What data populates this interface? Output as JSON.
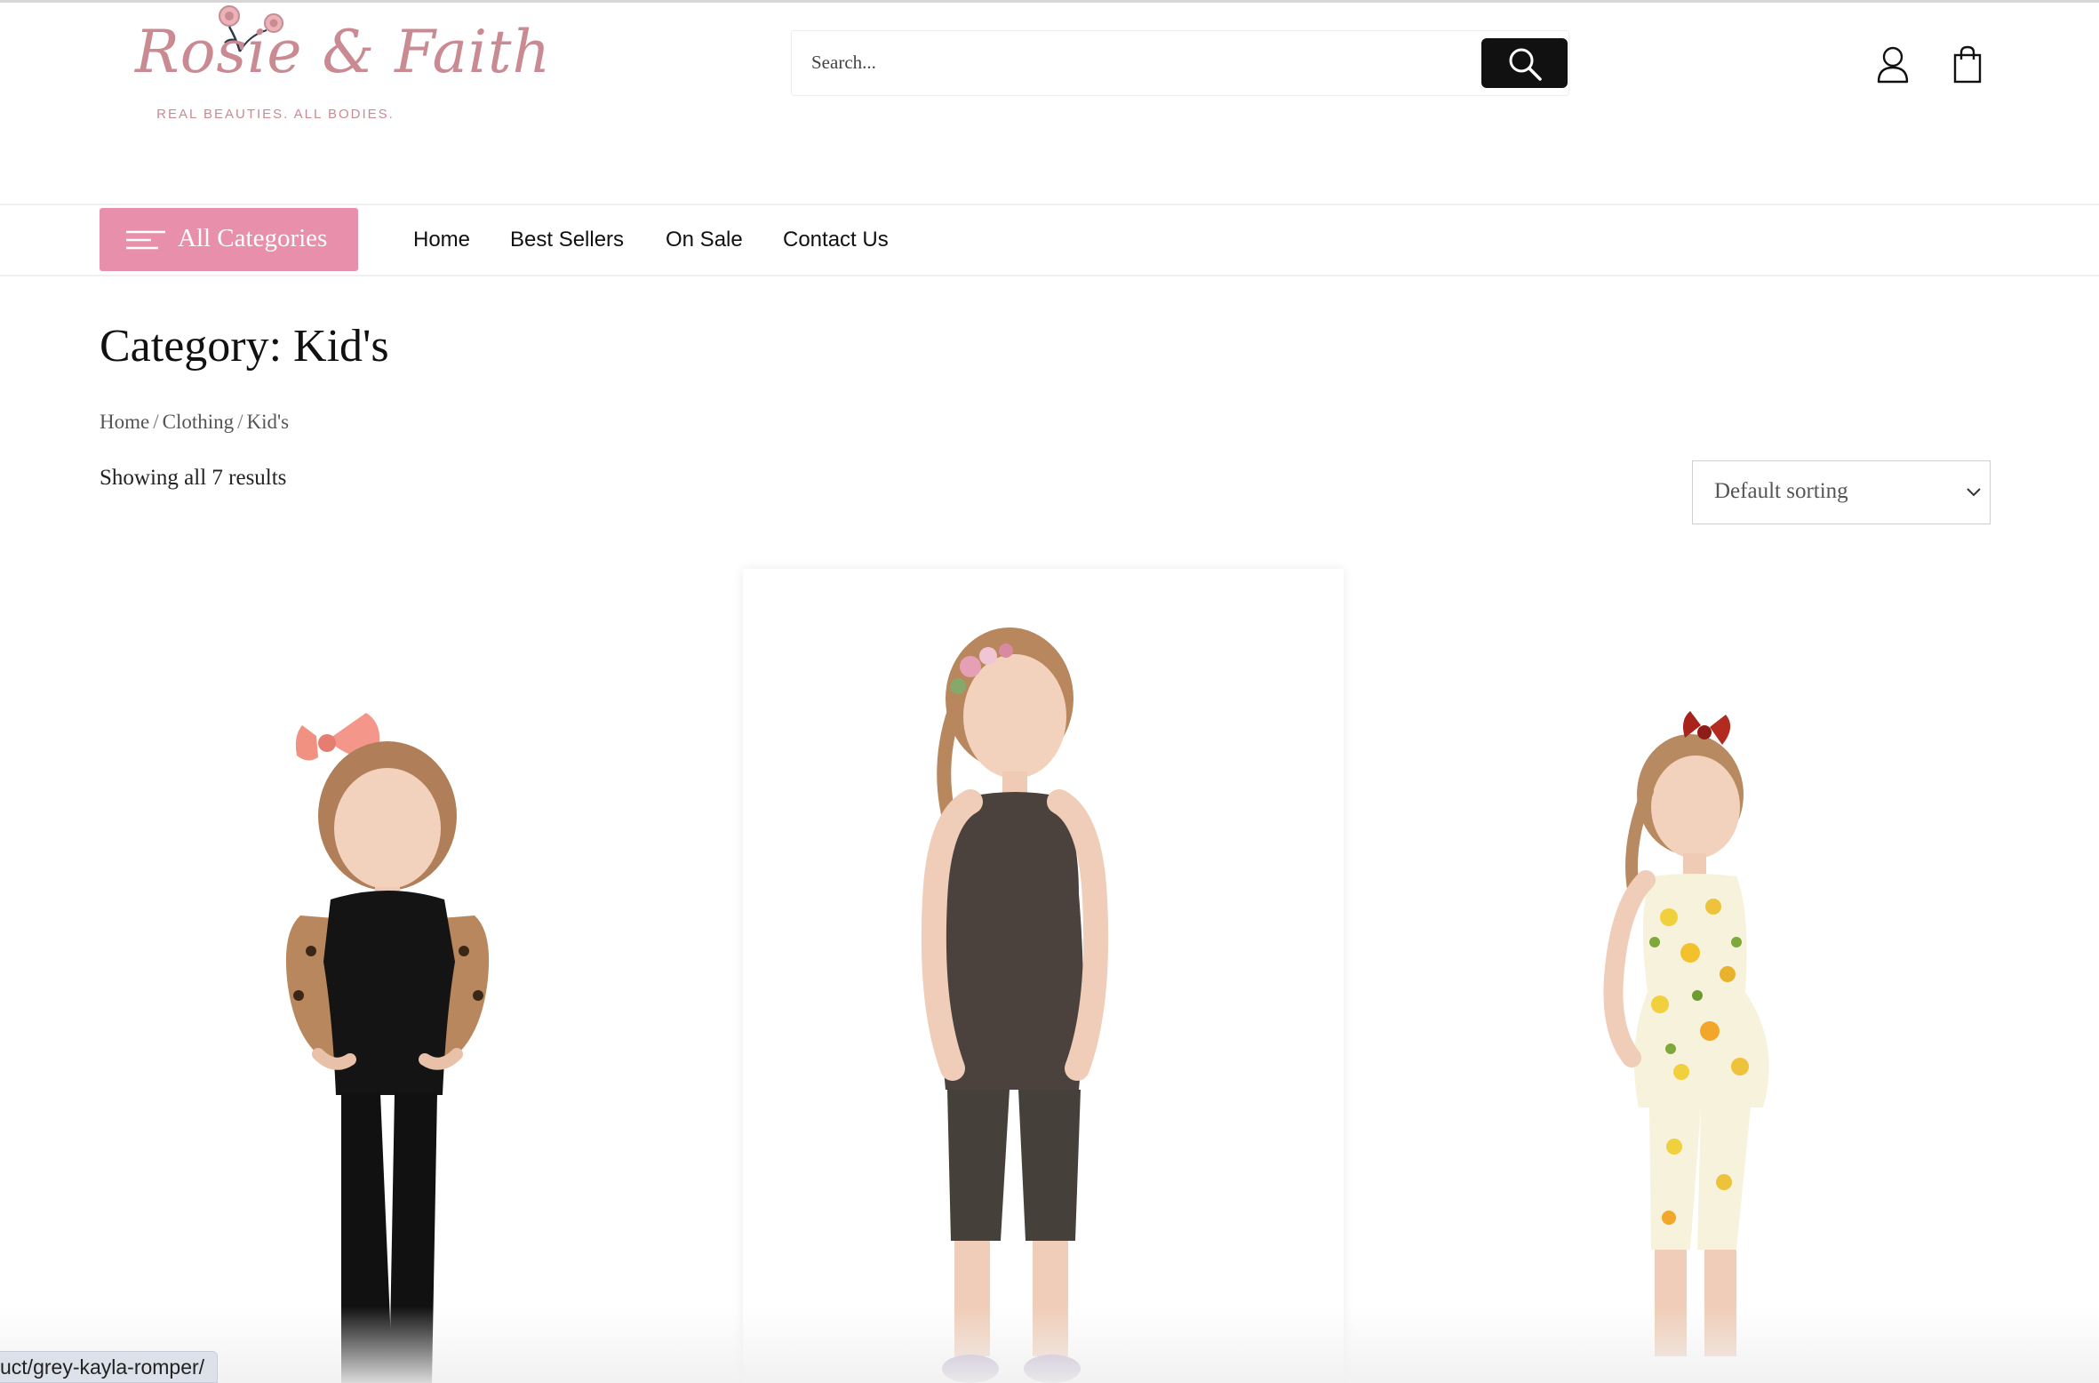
{
  "brand": {
    "name": "Rosie & Faith",
    "tagline": "REAL BEAUTIES. ALL BODIES."
  },
  "search": {
    "placeholder": "Search..."
  },
  "header": {
    "account_icon": "user-icon",
    "cart_icon": "shopping-bag-icon"
  },
  "nav": {
    "all_categories": "All Categories",
    "items": [
      {
        "label": "Home"
      },
      {
        "label": "Best Sellers"
      },
      {
        "label": "On Sale"
      },
      {
        "label": "Contact Us"
      }
    ]
  },
  "page": {
    "title": "Category: Kid's",
    "breadcrumb": [
      "Home",
      "Clothing",
      "Kid's"
    ],
    "result_count": "Showing all 7 results",
    "sort": {
      "selected": "Default sorting"
    }
  },
  "products": [
    {
      "image": "girl in black jumpsuit with leopard print sleeves and pink bow"
    },
    {
      "image": "girl in dark brown halter romper with flower crown"
    },
    {
      "image": "girl in lemon print romper with red bow"
    }
  ],
  "status_bar": {
    "url": "uct/grey-kayla-romper/"
  },
  "colors": {
    "accent": "#e88fab",
    "logo": "#c98a92",
    "search_button": "#111111"
  }
}
